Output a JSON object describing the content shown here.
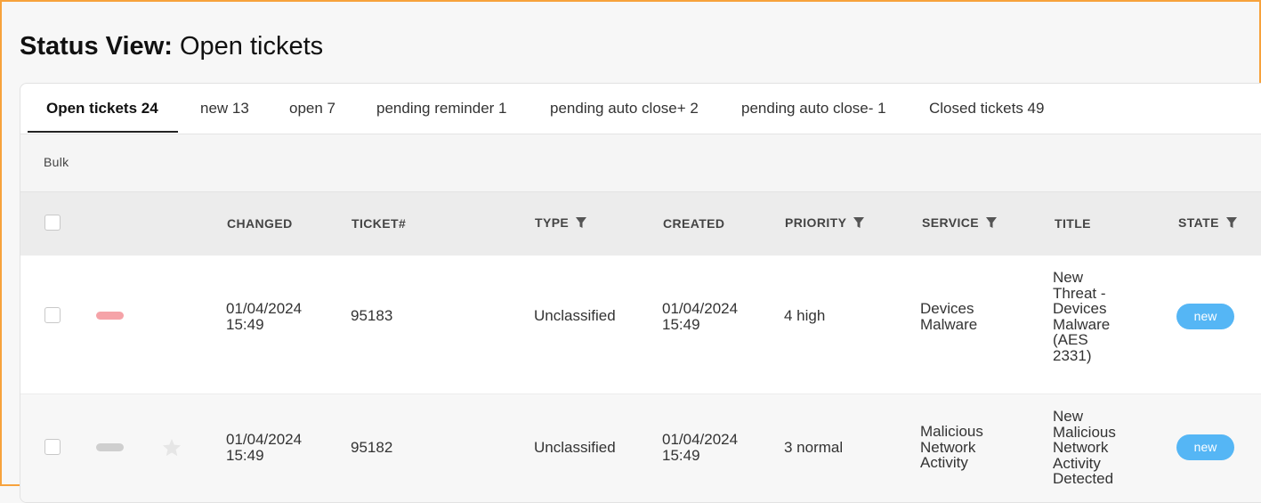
{
  "page": {
    "title_bold": "Status View:",
    "title_rest": "Open tickets"
  },
  "tabs": [
    {
      "label": "Open tickets 24"
    },
    {
      "label": "new 13"
    },
    {
      "label": "open 7"
    },
    {
      "label": "pending reminder 1"
    },
    {
      "label": "pending auto close+ 2"
    },
    {
      "label": "pending auto close- 1"
    },
    {
      "label": "Closed tickets 49"
    }
  ],
  "toolbar": {
    "bulk_label": "Bulk"
  },
  "columns": {
    "changed": "CHANGED",
    "ticket": "TICKET#",
    "type": "TYPE",
    "created": "CREATED",
    "priority": "PRIORITY",
    "service": "SERVICE",
    "title": "TITLE",
    "state": "STATE"
  },
  "rows": [
    {
      "priority_color": "#f5a3a8",
      "starred": false,
      "changed_date": "01/04/2024",
      "changed_time": "15:49",
      "ticket": "95183",
      "type": "Unclassified",
      "created_date": "01/04/2024",
      "created_time": "15:49",
      "priority": "4 high",
      "service": [
        "Devices",
        "Malware"
      ],
      "title": [
        "New",
        "Threat -",
        "Devices",
        "Malware",
        "(AES",
        "2331)"
      ],
      "state": "new"
    },
    {
      "priority_color": "#cfcfcf",
      "starred": true,
      "changed_date": "01/04/2024",
      "changed_time": "15:49",
      "ticket": "95182",
      "type": "Unclassified",
      "created_date": "01/04/2024",
      "created_time": "15:49",
      "priority": "3 normal",
      "service": [
        "Malicious",
        "Network",
        "Activity"
      ],
      "title": [
        "New",
        "Malicious",
        "Network",
        "Activity",
        "Detected"
      ],
      "state": "new"
    }
  ],
  "colors": {
    "accent_border": "#f7a23c",
    "state_badge": "#55b6f5",
    "star": "#e6e6e6"
  }
}
